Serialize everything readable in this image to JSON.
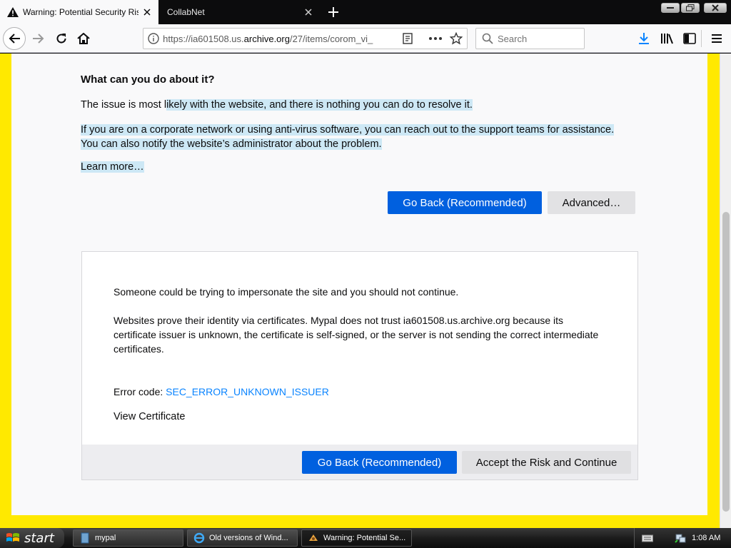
{
  "tabs": [
    {
      "title": "Warning: Potential Security Risk A",
      "icon": "warning-icon",
      "active": true
    },
    {
      "title": "CollabNet",
      "active": false
    }
  ],
  "nav": {
    "url_prefix": "https://ia601508.us.",
    "url_domain": "archive.org",
    "url_suffix": "/27/items/corom_vi_",
    "search_placeholder": "Search"
  },
  "content": {
    "heading": "What can you do about it?",
    "para1_pre": "The issue is most l",
    "para1_sel": "ikely with the website, and there is nothing you can do to resolve it.",
    "para2_line1": "If you are on a corporate network or using anti-virus software, you can reach out to the support teams for assistance.",
    "para2_line2": "You can also notify the website’s administrator about the problem.",
    "learn_more": "Learn more…",
    "go_back": "Go Back (Recommended)",
    "advanced": "Advanced…"
  },
  "advanced_panel": {
    "impersonate": "Someone could be trying to impersonate the site and you should not continue.",
    "cert_text": "Websites prove their identity via certificates. Mypal does not trust ia601508.us.archive.org because its certificate issuer is unknown, the certificate is self-signed, or the server is not sending the correct intermediate certificates.",
    "error_label": "Error code: ",
    "error_code": "SEC_ERROR_UNKNOWN_ISSUER",
    "view_cert": "View Certificate",
    "go_back": "Go Back (Recommended)",
    "accept": "Accept the Risk and Continue"
  },
  "taskbar": {
    "start": "start",
    "tasks": [
      {
        "label": "mypal"
      },
      {
        "label": "Old versions of Wind..."
      },
      {
        "label": "Warning: Potential Se..."
      }
    ],
    "clock": "1:08 AM"
  },
  "colors": {
    "accent": "#0060df",
    "warning_border": "#ffe900",
    "link": "#0a84ff",
    "selection": "#cde8f5"
  }
}
